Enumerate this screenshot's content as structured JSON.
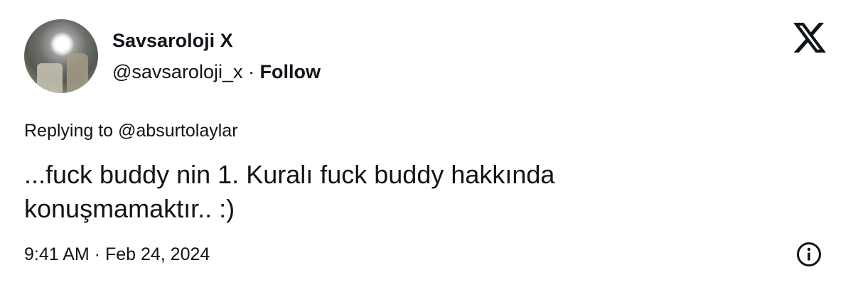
{
  "author": {
    "name": "Savsaroloji X",
    "handle": "@savsaroloji_x",
    "separator": "·",
    "follow_label": "Follow"
  },
  "reply": {
    "replying_label": "Replying to @absurtolaylar"
  },
  "tweet": {
    "text": "...fuck buddy nin 1. Kuralı fuck buddy hakkında konuşmamaktır.. :)",
    "time": "9:41 AM · Feb 24, 2024"
  },
  "icons": {
    "logo": "x-logo-icon",
    "info": "info-icon"
  }
}
